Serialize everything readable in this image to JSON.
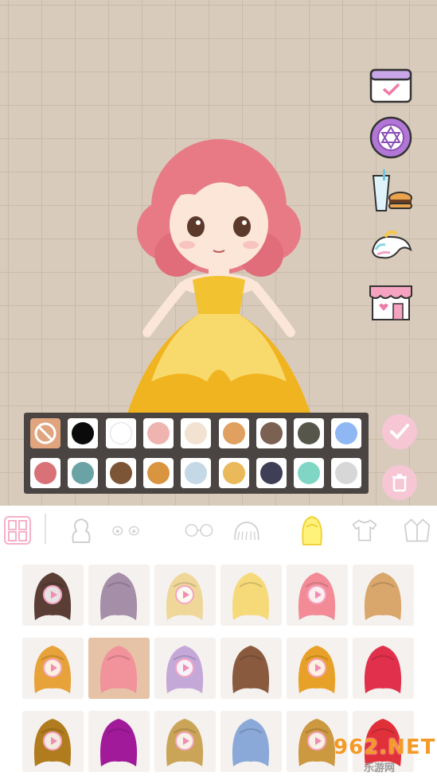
{
  "side_buttons": [
    {
      "name": "calendar-icon"
    },
    {
      "name": "magic-circle-icon"
    },
    {
      "name": "food-drink-icon"
    },
    {
      "name": "unicorn-icon"
    },
    {
      "name": "shop-icon"
    }
  ],
  "palette": {
    "row1": [
      "none",
      "#0b0b0b",
      "#ffffff",
      "#efb3b0",
      "#f1e2d1",
      "#dfa060",
      "#7a6152",
      "#56574a",
      "#8fb7f4"
    ],
    "row2": [
      "#d97178",
      "#6aa3a5",
      "#7b5536",
      "#d99440",
      "#c4d8e6",
      "#eab95a",
      "#3e3f56",
      "#7fd6c5",
      "#d7d7d7"
    ],
    "selected_index": 0
  },
  "actions": {
    "confirm": "check-icon",
    "delete": "trash-icon"
  },
  "categories": [
    {
      "name": "body-icon"
    },
    {
      "name": "eyes-icon"
    },
    {
      "name": "glasses-icon"
    },
    {
      "name": "hat-icon"
    },
    {
      "name": "hair-icon",
      "active": true
    },
    {
      "name": "shirt-icon"
    },
    {
      "name": "jacket-icon"
    }
  ],
  "hair_colors": [
    "#5a3e36",
    "#a58ea8",
    "#efd79a",
    "#f6da7a",
    "#f28b96",
    "#d9a66b",
    "#e7a23a",
    "#f2929a",
    "#c4a8d8",
    "#8a5a3f",
    "#e8a128",
    "#e0304c",
    "#b07c1e",
    "#a01a9a",
    "#caa457",
    "#8aa8d8",
    "#cc9840",
    "#e0303a"
  ],
  "watermark": {
    "number": "962.NET",
    "sub": "乐游网"
  }
}
